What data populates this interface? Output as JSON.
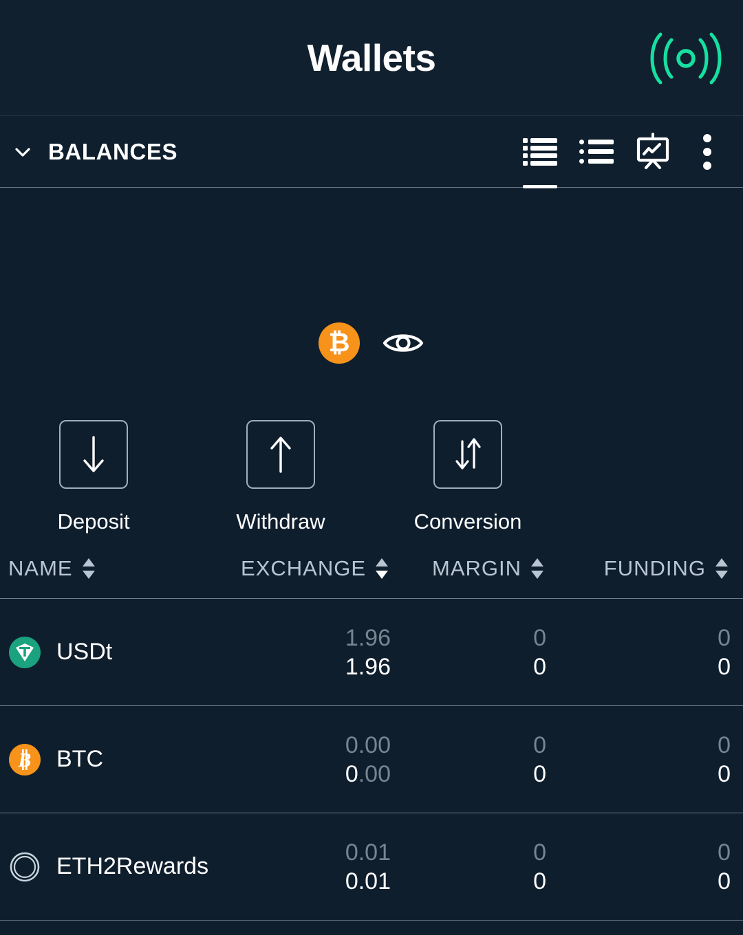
{
  "header": {
    "title": "Wallets",
    "signal_icon": "broadcast-signal-icon",
    "accent_color": "#16e0a0"
  },
  "toolbar": {
    "section_label": "BALANCES",
    "chevron_icon": "chevron-down-icon",
    "icons": [
      {
        "name": "list-dense-icon",
        "active": true
      },
      {
        "name": "list-bullet-icon",
        "active": false
      },
      {
        "name": "presentation-chart-icon",
        "active": false
      },
      {
        "name": "more-vertical-icon",
        "active": false
      }
    ]
  },
  "summary": {
    "currency_symbol": "₿",
    "currency_name": "BTC",
    "currency_color": "#f7931a",
    "visibility_icon": "eye-icon",
    "actions": [
      {
        "label": "Deposit",
        "icon": "arrow-down-icon"
      },
      {
        "label": "Withdraw",
        "icon": "arrow-up-icon"
      },
      {
        "label": "Conversion",
        "icon": "arrows-up-down-icon"
      }
    ]
  },
  "table": {
    "columns": [
      {
        "key": "name",
        "label": "NAME",
        "sort": "none"
      },
      {
        "key": "exchange",
        "label": "EXCHANGE",
        "sort": "desc"
      },
      {
        "key": "margin",
        "label": "MARGIN",
        "sort": "none"
      },
      {
        "key": "funding",
        "label": "FUNDING",
        "sort": "none"
      }
    ],
    "rows": [
      {
        "name": "USDt",
        "icon": "tether-icon",
        "icon_color": "#1ba27e",
        "exchange_top": "1.96",
        "exchange_bottom": "1.96",
        "margin_top": "0",
        "margin_bottom": "0",
        "funding_top": "0",
        "funding_bottom": "0"
      },
      {
        "name": "BTC",
        "icon": "bitcoin-icon",
        "icon_color": "#f7931a",
        "exchange_top": "0.00",
        "exchange_bottom_int": "0",
        "exchange_bottom_dec": ".00",
        "margin_top": "0",
        "margin_bottom": "0",
        "funding_top": "0",
        "funding_bottom": "0"
      },
      {
        "name": "ETH2Rewards",
        "icon": "eth2-icon",
        "icon_color": "#c8d4dd",
        "exchange_top": "0.01",
        "exchange_bottom": "0.01",
        "margin_top": "0",
        "margin_bottom": "0",
        "funding_top": "0",
        "funding_bottom": "0"
      }
    ]
  }
}
